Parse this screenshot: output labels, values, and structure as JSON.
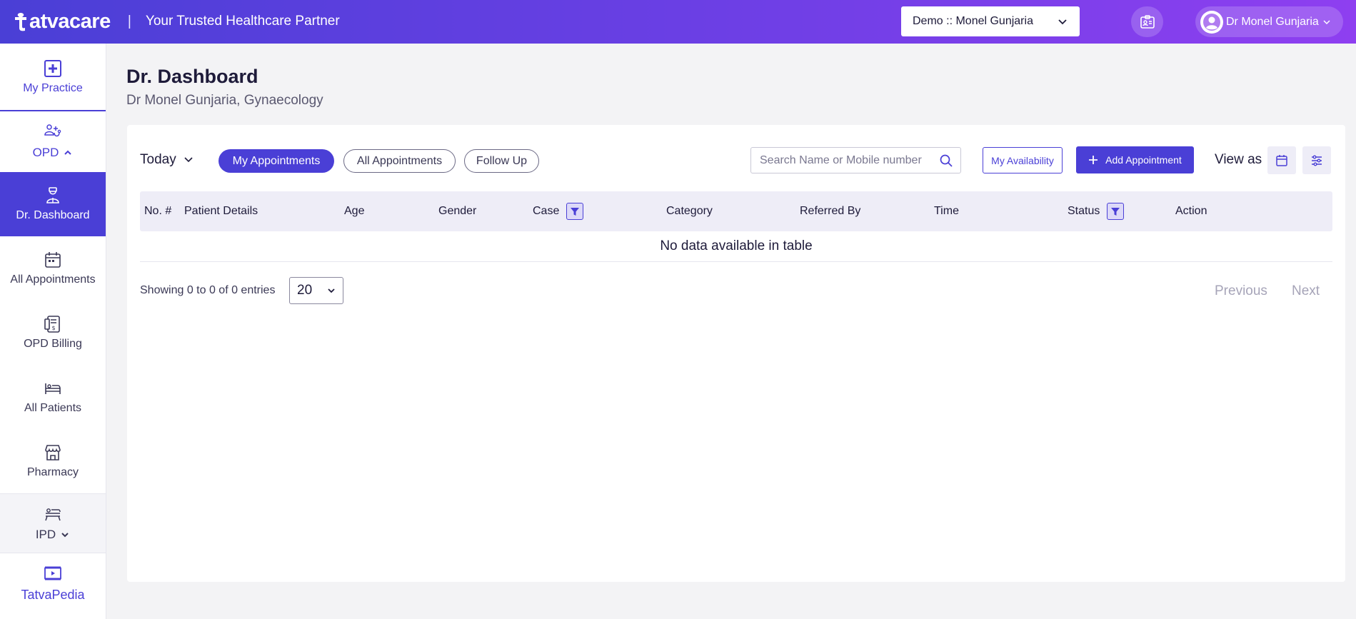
{
  "header": {
    "brand": "atvacare",
    "separator": "|",
    "tagline": "Your Trusted Healthcare Partner",
    "org_select": "Demo :: Monel Gunjaria",
    "user_name": "Dr Monel Gunjaria"
  },
  "sidebar": {
    "items": [
      {
        "label": "My Practice",
        "icon": "medical-cross-icon"
      },
      {
        "label": "OPD",
        "icon": "doctor-patient-icon",
        "expanded": true
      },
      {
        "label": "Dr. Dashboard",
        "icon": "doctor-icon",
        "active": true
      },
      {
        "label": "All Appointments",
        "icon": "calendar-icon"
      },
      {
        "label": "OPD Billing",
        "icon": "billing-icon"
      },
      {
        "label": "All Patients",
        "icon": "bed-icon"
      },
      {
        "label": "Pharmacy",
        "icon": "store-icon"
      },
      {
        "label": "IPD",
        "icon": "hospital-bed-icon",
        "expanded": false
      },
      {
        "label": "TatvaPedia",
        "icon": "video-icon"
      }
    ]
  },
  "page": {
    "title": "Dr. Dashboard",
    "subtitle": "Dr Monel Gunjaria, Gynaecology"
  },
  "toolbar": {
    "period": "Today",
    "tabs": [
      "My Appointments",
      "All Appointments",
      "Follow Up"
    ],
    "active_tab": "My Appointments",
    "search_placeholder": "Search Name or Mobile number",
    "availability_label": "My Availability",
    "add_label": "Add Appointment",
    "view_as_label": "View as"
  },
  "table": {
    "columns": [
      "No. #",
      "Patient Details",
      "Age",
      "Gender",
      "Case",
      "Category",
      "Referred By",
      "Time",
      "Status",
      "Action"
    ],
    "empty_message": "No data available in table"
  },
  "footer": {
    "showing": "Showing 0 to 0 of 0 entries",
    "page_size": "20",
    "previous": "Previous",
    "next": "Next"
  },
  "colors": {
    "primary": "#4a3fd6",
    "header_gradient_end": "#8e3ff0"
  }
}
